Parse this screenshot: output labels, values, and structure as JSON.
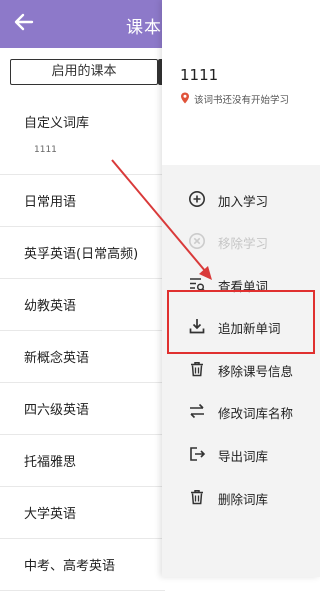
{
  "header": {
    "title": "课本不"
  },
  "tabs": {
    "active_label": "启用的课本"
  },
  "book_list": {
    "custom": {
      "label": "自定义词库",
      "sub": "1111"
    },
    "items": [
      "日常用语",
      "英孚英语(日常高频)",
      "幼教英语",
      "新概念英语",
      "四六级英语",
      "托福雅思",
      "大学英语",
      "中考、高考英语"
    ]
  },
  "drawer": {
    "book_title": "1111",
    "status": "该词书还没有开始学习",
    "menu": [
      {
        "label": "加入学习",
        "icon": "plus-circle-icon",
        "enabled": true
      },
      {
        "label": "移除学习",
        "icon": "x-circle-icon",
        "enabled": false
      },
      {
        "label": "查看单词",
        "icon": "list-search-icon",
        "enabled": true
      },
      {
        "label": "追加新单词",
        "icon": "download-icon",
        "enabled": true
      },
      {
        "label": "移除课号信息",
        "icon": "trash-icon",
        "enabled": true
      },
      {
        "label": "修改词库名称",
        "icon": "swap-icon",
        "enabled": true
      },
      {
        "label": "导出词库",
        "icon": "export-icon",
        "enabled": true
      },
      {
        "label": "删除词库",
        "icon": "trash-icon",
        "enabled": true
      }
    ]
  },
  "colors": {
    "accent": "#8d79c9",
    "highlight": "#e0302f",
    "arrow": "#d93a3a"
  }
}
